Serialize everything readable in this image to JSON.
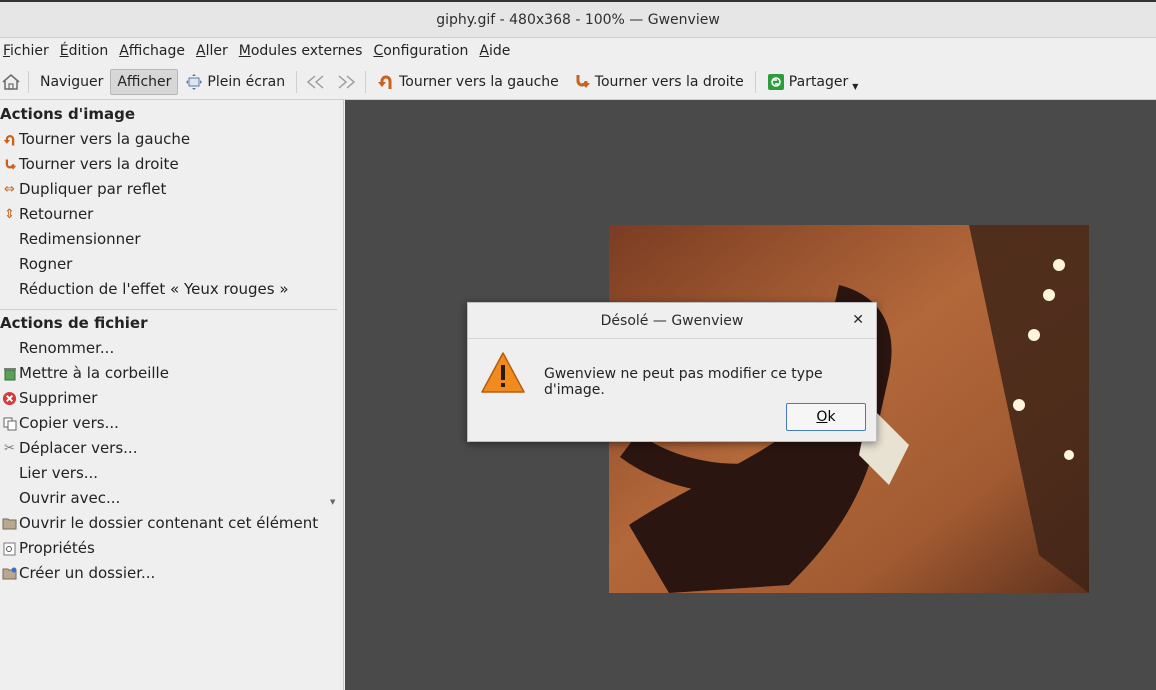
{
  "window": {
    "title": "giphy.gif - 480x368 - 100%  — Gwenview"
  },
  "menubar": {
    "items": [
      {
        "label": "Fichier",
        "u": "F",
        "rest": "ichier"
      },
      {
        "label": "Édition",
        "u": "É",
        "rest": "dition"
      },
      {
        "label": "Affichage",
        "u": "A",
        "rest": "ffichage"
      },
      {
        "label": "Aller",
        "u": "A",
        "rest": "ller"
      },
      {
        "label": "Modules externes",
        "u": "M",
        "rest": "odules externes"
      },
      {
        "label": "Configuration",
        "u": "C",
        "rest": "onfiguration"
      },
      {
        "label": "Aide",
        "u": "A",
        "rest": "ide"
      }
    ]
  },
  "toolbar": {
    "browse": "Naviguer",
    "view": "Afficher",
    "fullscreen": "Plein écran",
    "rotate_left": "Tourner vers la gauche",
    "rotate_right": "Tourner vers la droite",
    "share": "Partager"
  },
  "sidebar": {
    "image_actions_title": "Actions d'image",
    "image_actions": [
      "Tourner vers la gauche",
      "Tourner vers la droite",
      "Dupliquer par reflet",
      "Retourner",
      "Redimensionner",
      "Rogner",
      "Réduction de l'effet « Yeux rouges »"
    ],
    "file_actions_title": "Actions de fichier",
    "file_actions": [
      "Renommer...",
      "Mettre à la corbeille",
      "Supprimer",
      "Copier vers...",
      "Déplacer vers...",
      "Lier vers...",
      "Ouvrir avec...",
      "Ouvrir le dossier contenant cet élément",
      "Propriétés",
      "Créer un dossier..."
    ]
  },
  "dialog": {
    "title": "Désolé — Gwenview",
    "message": "Gwenview ne peut pas modifier ce type d'image.",
    "ok_u": "O",
    "ok_rest": "k"
  },
  "colors": {
    "viewer_bg": "#4a4a4a",
    "warning": "#f28b1e",
    "accent": "#4a7bc0"
  }
}
